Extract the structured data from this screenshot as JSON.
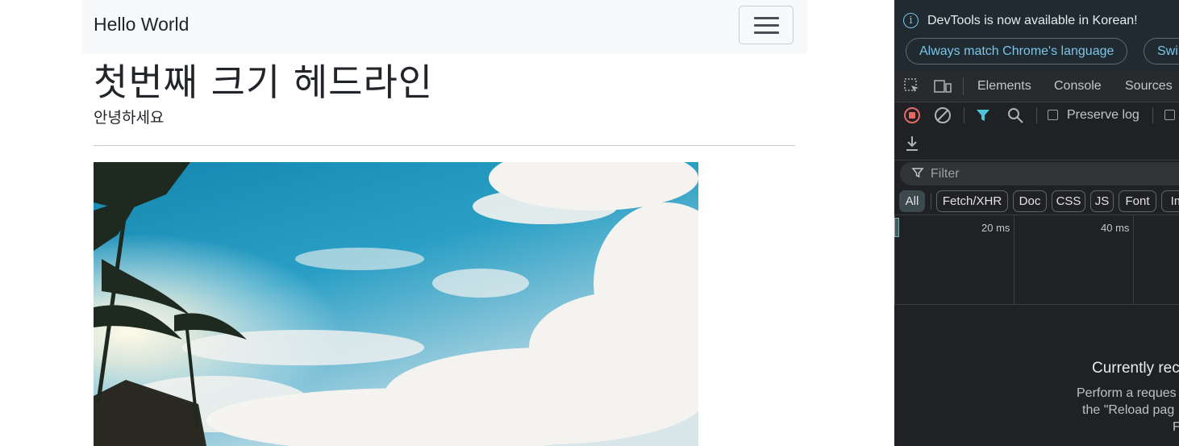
{
  "page": {
    "navbar": {
      "brand": "Hello World"
    },
    "headline": "첫번째 크기 헤드라인",
    "subtext": "안녕하세요"
  },
  "devtools": {
    "infobar": {
      "message": "DevTools is now available in Korean!",
      "match_language_button": "Always match Chrome's language",
      "switch_button": "Swi"
    },
    "tabs": [
      "Elements",
      "Console",
      "Sources"
    ],
    "toolbar": {
      "preserve_log_label": "Preserve log"
    },
    "filter": {
      "placeholder": "Filter"
    },
    "type_filters": [
      "All",
      "Fetch/XHR",
      "Doc",
      "CSS",
      "JS",
      "Font",
      "Im"
    ],
    "active_type_filter": "All",
    "timeline": {
      "ticks": [
        "20 ms",
        "40 ms"
      ]
    },
    "empty_state": {
      "title": "Currently rec",
      "line1": "Perform a reques",
      "line2": "the \"Reload pag",
      "line3": "F"
    },
    "colors": {
      "accent": "#7cc4e8",
      "record": "#e46962",
      "filter_icon": "#4fc3d8"
    }
  }
}
